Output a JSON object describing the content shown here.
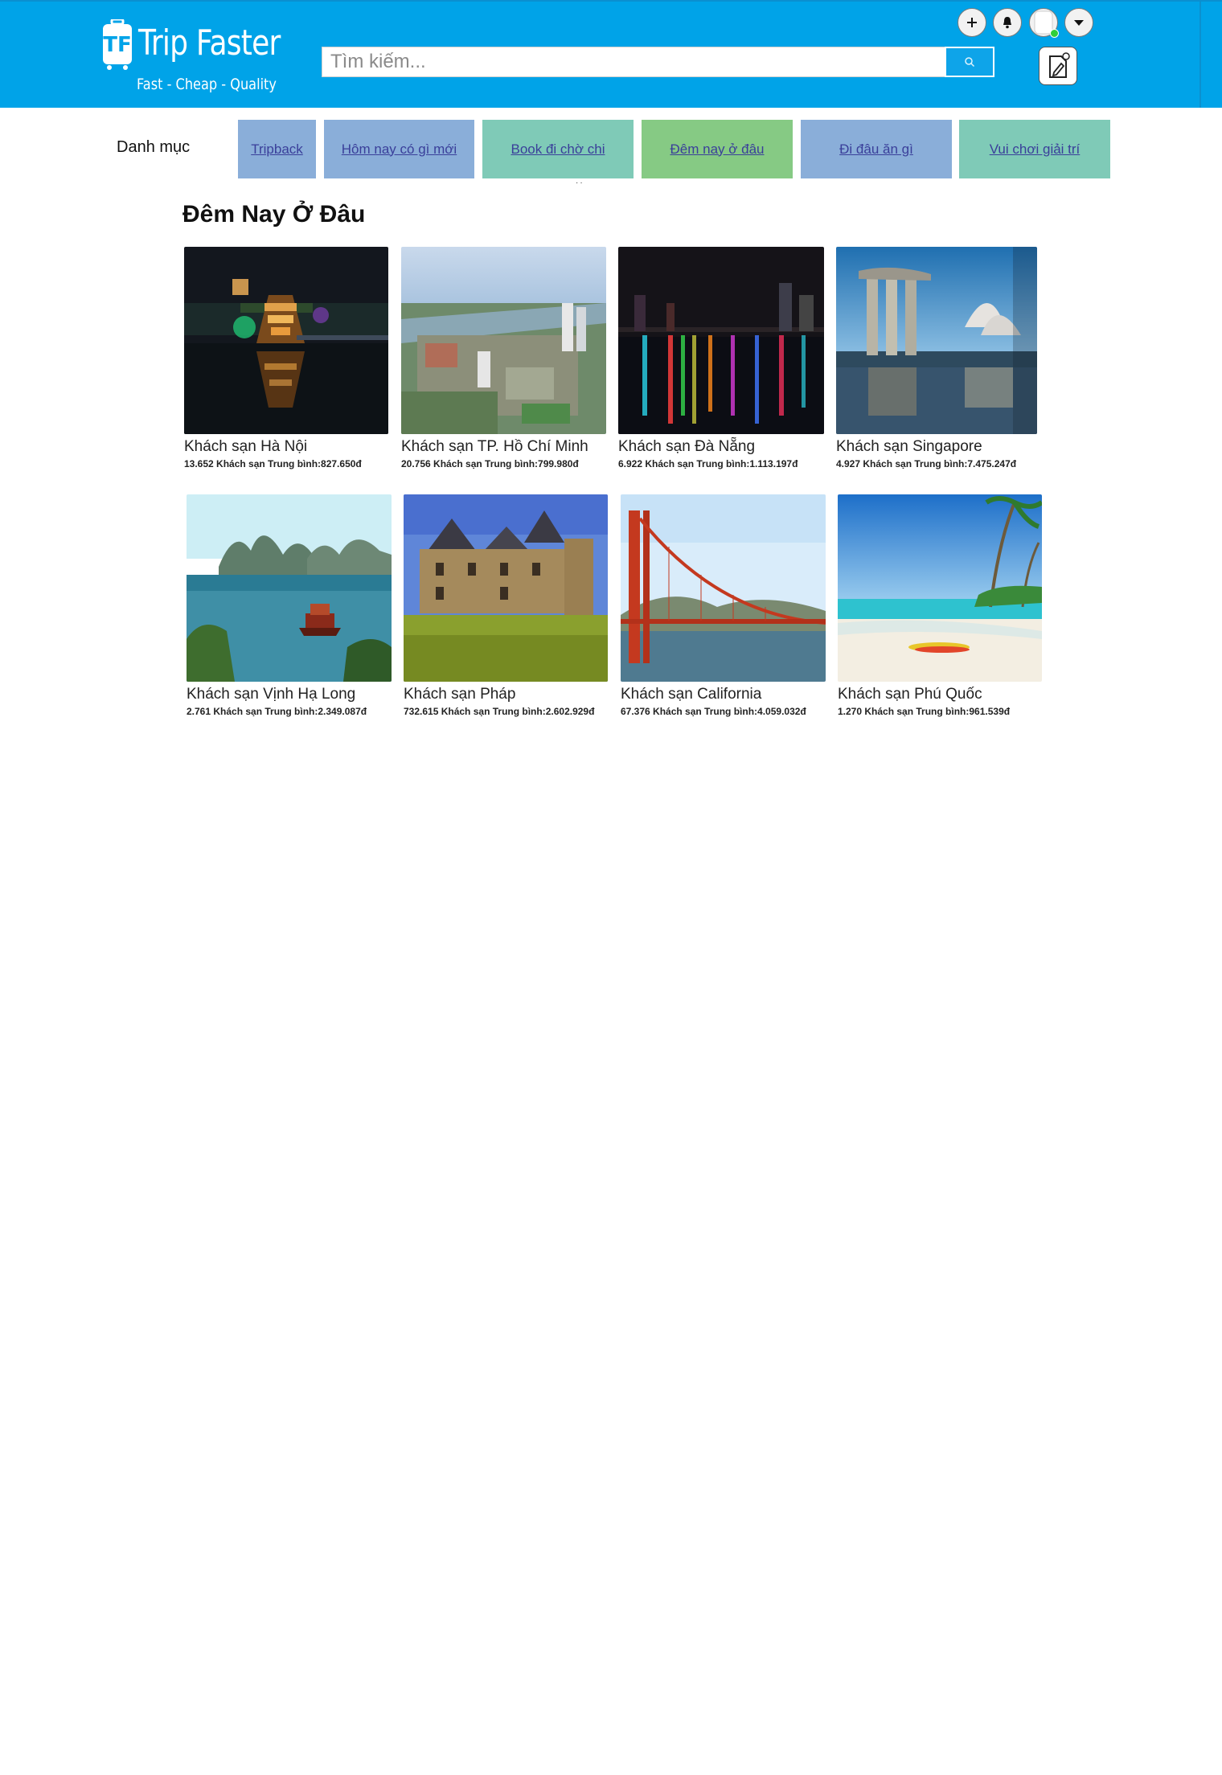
{
  "header": {
    "logo": {
      "title": "Trip Faster",
      "tagline": "Fast - Cheap - Quality",
      "icon": "luggage-tf-logo"
    },
    "search": {
      "placeholder": "Tìm kiếm...",
      "value": "",
      "button_icon": "search-icon"
    },
    "actions": [
      {
        "name": "add",
        "icon": "plus-icon"
      },
      {
        "name": "notifications",
        "icon": "bell-icon"
      },
      {
        "name": "profile",
        "icon": "avatar-icon"
      },
      {
        "name": "menu",
        "icon": "caret-down-icon"
      }
    ],
    "edit_icon": "pencil-document-icon",
    "colors": {
      "bar": "#00a3e8",
      "online": "#2fcf3a"
    }
  },
  "nav": {
    "label": "Danh mục",
    "tabs": [
      {
        "label": "Tripback",
        "color": "#8aaed9"
      },
      {
        "label": "Hôm nay có gì mới",
        "color": "#8aaed9"
      },
      {
        "label": "Book đi chờ chi",
        "color": "#7fcab7"
      },
      {
        "label": "Đêm nay ở đâu",
        "color": "#86ca84"
      },
      {
        "label": "Đi đâu ăn gì",
        "color": "#8aaed9"
      },
      {
        "label": "Vui chơi giải trí",
        "color": "#7fcab7"
      }
    ]
  },
  "section": {
    "title": "Đêm Nay Ở Đâu",
    "cards": [
      {
        "name": "Khách sạn Hà Nội",
        "meta": "13.652 Khách sạn Trung bình:827.650đ",
        "image": "hanoi-night-pagoda"
      },
      {
        "name": "Khách sạn TP. Hồ Chí Minh",
        "meta": "20.756 Khách sạn Trung bình:799.980đ",
        "image": "hcmc-city-aerial"
      },
      {
        "name": "Khách sạn Đà Nẵng",
        "meta": "6.922 Khách sạn Trung bình:1.113.197đ",
        "image": "danang-night-skyline"
      },
      {
        "name": "Khách sạn Singapore",
        "meta": "4.927 Khách sạn Trung bình:7.475.247đ",
        "image": "singapore-marina-bay"
      },
      {
        "name": "Khách sạn Vịnh Hạ Long",
        "meta": "2.761 Khách sạn Trung bình:2.349.087đ",
        "image": "halong-bay-boat"
      },
      {
        "name": "Khách sạn Pháp",
        "meta": "732.615 Khách sạn Trung bình:2.602.929đ",
        "image": "france-chateau"
      },
      {
        "name": "Khách sạn California",
        "meta": "67.376 Khách sạn Trung bình:4.059.032đ",
        "image": "golden-gate-bridge"
      },
      {
        "name": "Khách sạn Phú Quốc",
        "meta": "1.270 Khách sạn Trung bình:961.539đ",
        "image": "phuquoc-beach-kayak"
      }
    ]
  }
}
